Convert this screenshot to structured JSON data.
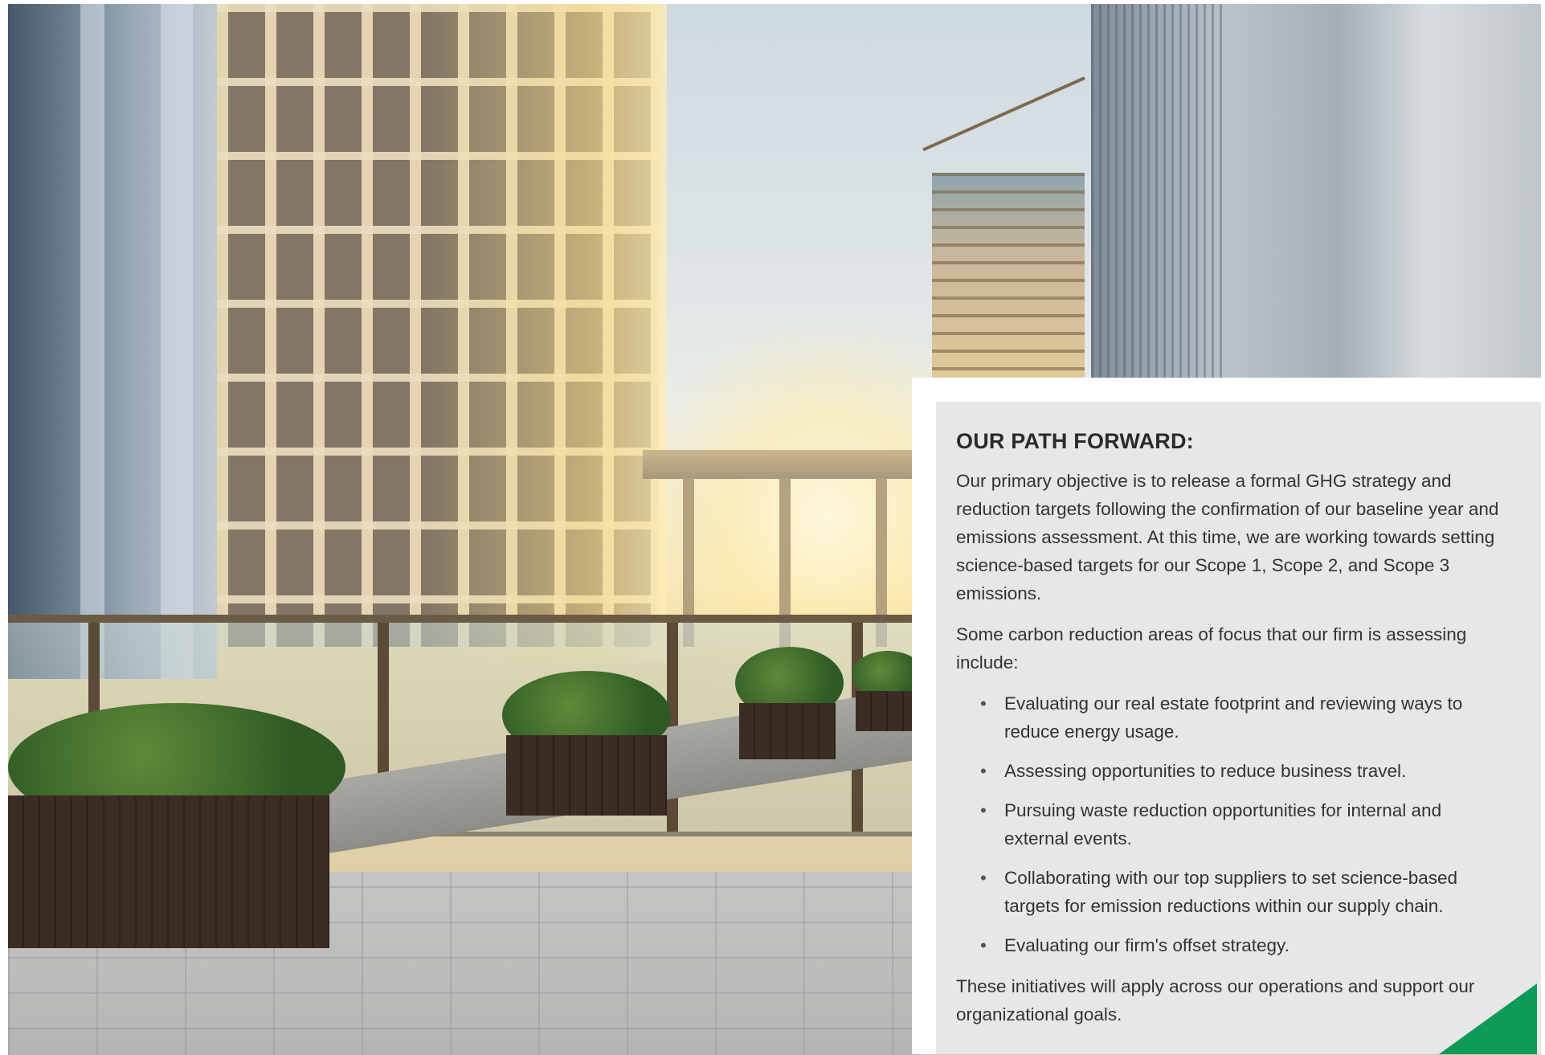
{
  "panel": {
    "title": "OUR PATH FORWARD:",
    "intro": "Our primary objective is to release a formal GHG strategy and reduction targets following the confirmation of our baseline year and emissions assessment. At this time, we are working towards setting science-based targets for our Scope 1, Scope 2, and Scope 3 emissions.",
    "lead_in": "Some carbon reduction areas of focus that our firm is assessing include:",
    "bullets": [
      "Evaluating our real estate footprint and reviewing ways to reduce energy usage.",
      "Assessing opportunities to reduce business travel.",
      "Pursuing waste reduction opportunities for internal and external events.",
      "Collaborating with our top suppliers to set science-based targets for emission reductions within our supply chain.",
      "Evaluating our firm's offset strategy."
    ],
    "closing": "These initiatives will apply across our operations and support our organizational goals."
  },
  "bullet_glyph": "•",
  "colors": {
    "panel_bg": "#e7e7e7",
    "accent_green": "#0f9b57",
    "text": "#333333"
  }
}
